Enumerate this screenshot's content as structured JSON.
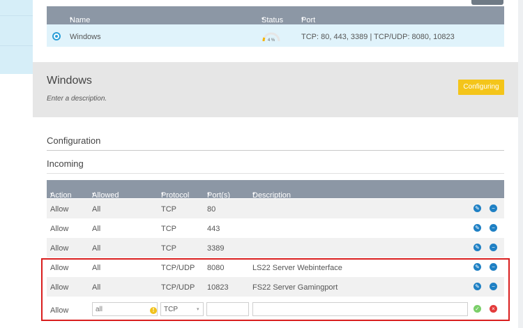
{
  "server_table": {
    "headers": {
      "name": "Name",
      "status": "Status",
      "port": "Port"
    },
    "row": {
      "name": "Windows",
      "status_percent_label": "4 %",
      "status_percent": 4,
      "ports": "TCP: 80, 443, 3389 | TCP/UDP: 8080, 10823"
    }
  },
  "detail": {
    "title": "Windows",
    "description": "Enter a description.",
    "configuring_button": "Configuring"
  },
  "sections": {
    "configuration": "Configuration",
    "incoming": "Incoming"
  },
  "rules": {
    "headers": {
      "action": "Action",
      "allowed_ip": "Allowed IP",
      "protocol": "Protocol",
      "ports": "Port(s)",
      "description": "Description"
    },
    "rows": [
      {
        "action": "Allow",
        "ip": "All",
        "protocol": "TCP",
        "port": "80",
        "description": ""
      },
      {
        "action": "Allow",
        "ip": "All",
        "protocol": "TCP",
        "port": "443",
        "description": ""
      },
      {
        "action": "Allow",
        "ip": "All",
        "protocol": "TCP",
        "port": "3389",
        "description": ""
      },
      {
        "action": "Allow",
        "ip": "All",
        "protocol": "TCP/UDP",
        "port": "8080",
        "description": "LS22 Server Webinterface"
      },
      {
        "action": "Allow",
        "ip": "All",
        "protocol": "TCP/UDP",
        "port": "10823",
        "description": "FS22 Server Gamingport"
      }
    ],
    "new_rule": {
      "action": "Allow",
      "ip_placeholder": "all",
      "protocol_value": "TCP",
      "port_value": "",
      "description_value": ""
    }
  },
  "colors": {
    "accent": "#2b9fd8",
    "header": "#8c97a5",
    "button": "#f4c51a",
    "highlight": "#d91e1e"
  },
  "icons": {
    "edit": "pencil-icon",
    "remove": "minus-circle-icon",
    "save": "check-icon",
    "cancel": "close-icon",
    "warning": "warning-icon"
  }
}
